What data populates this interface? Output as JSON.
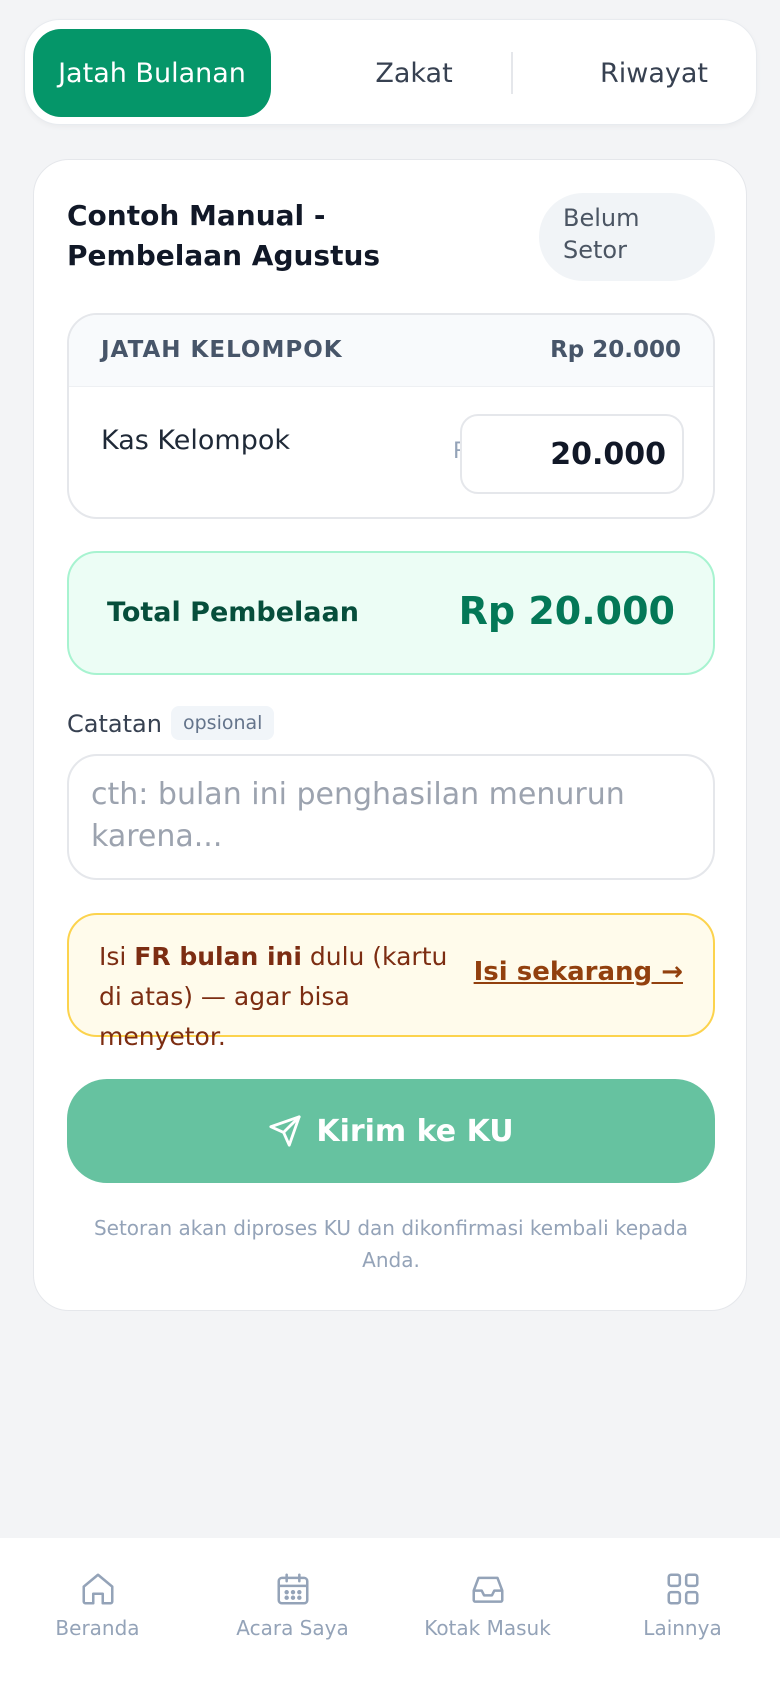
{
  "tabs": [
    {
      "label": "Jatah Bulanan",
      "active": true
    },
    {
      "label": "Zakat",
      "active": false
    },
    {
      "label": "Riwayat",
      "active": false
    }
  ],
  "card": {
    "title": "Contoh Manual - Pembelaan Agustus",
    "status": "Belum Setor"
  },
  "jatah": {
    "header_label": "JATAH KELOMPOK",
    "header_value": "Rp 20.000",
    "item_label": "Kas Kelompok",
    "currency": "Rp",
    "amount": "20.000"
  },
  "total": {
    "label": "Total Pembelaan",
    "value": "Rp 20.000"
  },
  "notes": {
    "label": "Catatan",
    "tag": "opsional",
    "placeholder": "cth: bulan ini penghasilan menurun karena..."
  },
  "warning": {
    "prefix": "Isi ",
    "bold": "FR bulan ini",
    "suffix": " dulu (kartu di atas) — agar bisa menyetor.",
    "link": "Isi sekarang →"
  },
  "submit": {
    "label": "Kirim ke KU",
    "icon": "send-icon"
  },
  "footnote": "Setoran akan diproses KU dan dikonfirmasi kembali kepada Anda.",
  "nav": [
    {
      "label": "Beranda",
      "icon": "home-icon"
    },
    {
      "label": "Acara Saya",
      "icon": "calendar-icon"
    },
    {
      "label": "Kotak Masuk",
      "icon": "inbox-icon"
    },
    {
      "label": "Lainnya",
      "icon": "grid-icon"
    }
  ],
  "colors": {
    "primary": "#059669",
    "primary_disabled": "#66c2a0",
    "success_bg": "#ecfdf5",
    "warning_bg": "#fffbeb",
    "warning_border": "#fcd34d"
  }
}
